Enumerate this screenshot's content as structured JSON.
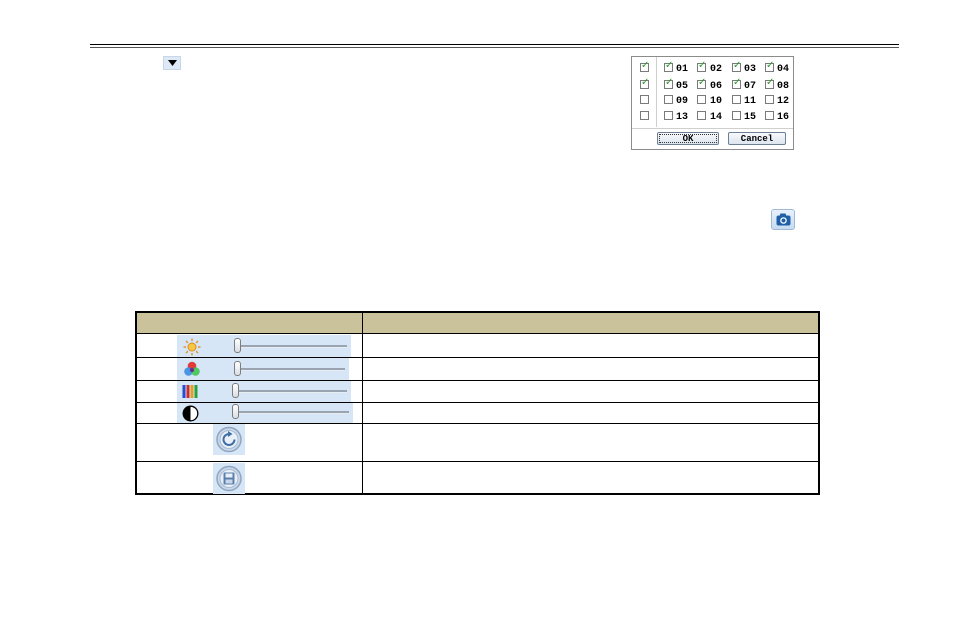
{
  "header": {},
  "channel_selector": {
    "all_rows": [
      true,
      true,
      false,
      false
    ],
    "channels": [
      {
        "label": "01",
        "checked": true
      },
      {
        "label": "02",
        "checked": true
      },
      {
        "label": "03",
        "checked": true
      },
      {
        "label": "04",
        "checked": true
      },
      {
        "label": "05",
        "checked": true
      },
      {
        "label": "06",
        "checked": true
      },
      {
        "label": "07",
        "checked": true
      },
      {
        "label": "08",
        "checked": true
      },
      {
        "label": "09",
        "checked": false
      },
      {
        "label": "10",
        "checked": false
      },
      {
        "label": "11",
        "checked": false
      },
      {
        "label": "12",
        "checked": false
      },
      {
        "label": "13",
        "checked": false
      },
      {
        "label": "14",
        "checked": false
      },
      {
        "label": "15",
        "checked": false
      },
      {
        "label": "16",
        "checked": false
      }
    ],
    "ok_label": "OK",
    "cancel_label": "Cancel",
    "check_color": "#2a9a2a"
  },
  "icons": {
    "dropdown": "chevron-down-icon",
    "snapshot": "camera-icon"
  },
  "table": {
    "header_color": "#c9c29a",
    "sliders": [
      {
        "icon": "brightness-icon",
        "level": 0.02
      },
      {
        "icon": "saturation-icon",
        "level": 0.02
      },
      {
        "icon": "hue-icon",
        "level": 0.02
      },
      {
        "icon": "contrast-icon",
        "level": 0.02
      }
    ],
    "buttons": [
      {
        "icon": "refresh-icon"
      },
      {
        "icon": "save-icon"
      }
    ]
  }
}
